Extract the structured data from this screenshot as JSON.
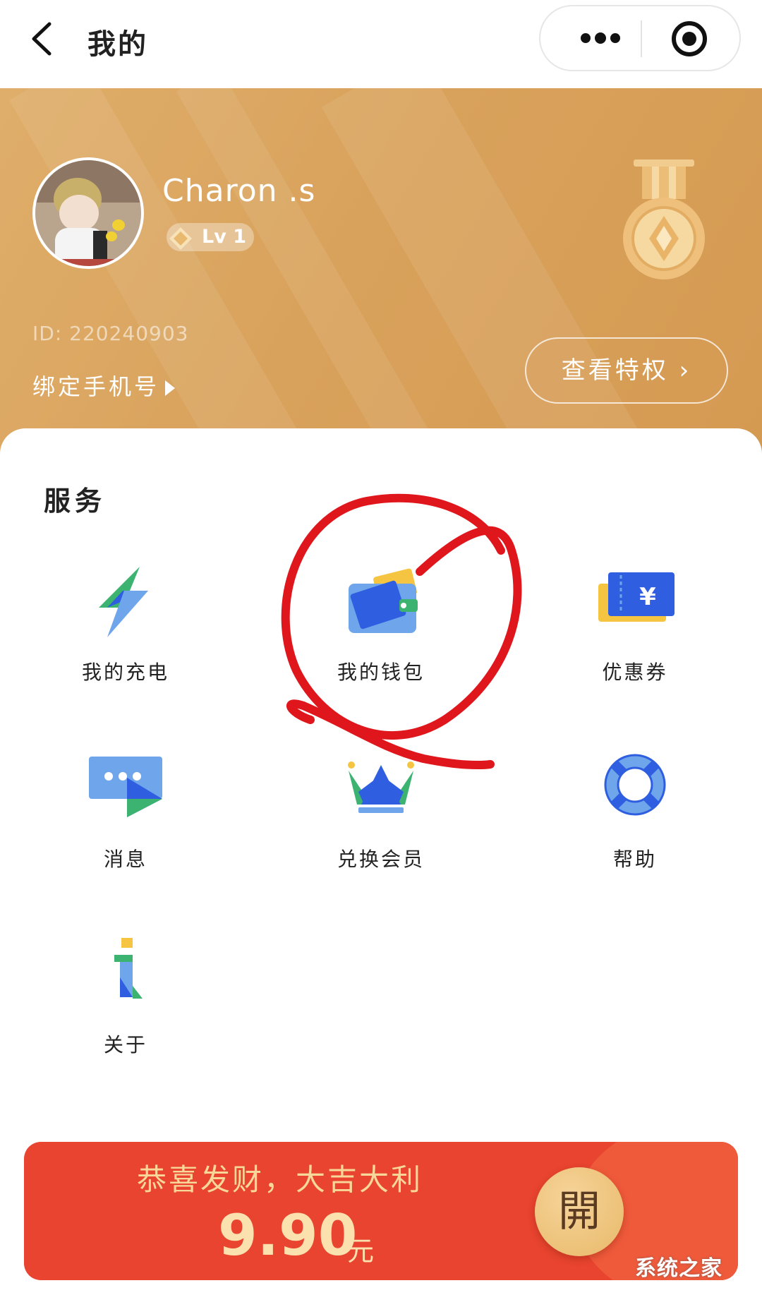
{
  "nav": {
    "title": "我的"
  },
  "profile": {
    "username": "Charon .s",
    "level": "Lv 1",
    "user_id": "ID: 220240903",
    "bind_phone": "绑定手机号",
    "privilege_button": "查看特权",
    "privilege_chevron": "›"
  },
  "services": {
    "title": "服务",
    "items": [
      {
        "label": "我的充电",
        "icon": "lightning-icon"
      },
      {
        "label": "我的钱包",
        "icon": "wallet-icon"
      },
      {
        "label": "优惠券",
        "icon": "coupon-icon"
      },
      {
        "label": "消息",
        "icon": "message-icon"
      },
      {
        "label": "兑换会员",
        "icon": "crown-icon"
      },
      {
        "label": "帮助",
        "icon": "lifebuoy-icon"
      },
      {
        "label": "关于",
        "icon": "info-icon"
      }
    ]
  },
  "banner": {
    "slogan": "恭喜发财，大吉大利",
    "amount": "9.90",
    "unit": "元",
    "open_label": "開"
  },
  "watermark": "系统之家",
  "colors": {
    "header_gold": "#d9a25c",
    "banner_red": "#e8442f",
    "annotation_red": "#e0161d",
    "icon_blue": "#2f5fe0",
    "icon_green": "#3cb371",
    "icon_yellow": "#f5c542"
  }
}
